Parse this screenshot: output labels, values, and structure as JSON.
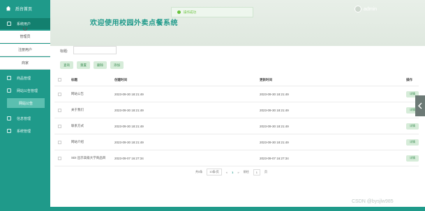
{
  "sidebar": {
    "home": "后台首页",
    "items": [
      {
        "label": "系统用户"
      },
      {
        "label": "管理员"
      },
      {
        "label": "注册用户"
      },
      {
        "label": "商家"
      },
      {
        "label": "商品管理"
      },
      {
        "label": "网站公告管理"
      },
      {
        "label": "网站公告"
      },
      {
        "label": "信息管理"
      },
      {
        "label": "系统管理"
      }
    ]
  },
  "header": {
    "title": "欢迎使用校园外卖点餐系统",
    "toast": "操作成功",
    "user": "admin"
  },
  "search": {
    "label": "标题:",
    "placeholder": ""
  },
  "buttons": {
    "search": "查询",
    "reset": "重置",
    "delete": "删除",
    "add": "添加"
  },
  "table": {
    "columns": [
      "标题",
      "创建时间",
      "更新时间",
      "操作"
    ],
    "rows": [
      {
        "title": "网站公告",
        "created": "2023-09-30 18:21:49",
        "updated": "2023-09-30 18:21:49",
        "action": "详情"
      },
      {
        "title": "关于我们",
        "created": "2023-09-30 18:21:49",
        "updated": "2023-09-30 18:21:49",
        "action": "详情"
      },
      {
        "title": "联系方式",
        "created": "2023-09-30 18:21:49",
        "updated": "2023-09-30 18:21:49",
        "action": "详情"
      },
      {
        "title": "网站介绍",
        "created": "2023-09-30 18:21:49",
        "updated": "2023-09-30 18:21:49",
        "action": "详情"
      },
      {
        "title": "SDI 出示高级大学商品目",
        "created": "2023-09-07 16:27:34",
        "updated": "2023-09-07 16:27:34",
        "action": "详情"
      }
    ]
  },
  "pager": {
    "total": "共5条",
    "size": "10条/页",
    "prev": "<",
    "page": "1",
    "next": ">",
    "goto": "前往",
    "goto_page": "1",
    "pageunit": "页"
  },
  "watermark": "CSDN @bysjlw985",
  "colors": {
    "primary": "#1f9a8a",
    "accent_btn": "#d6ecd9",
    "toast": "#67c23a"
  }
}
